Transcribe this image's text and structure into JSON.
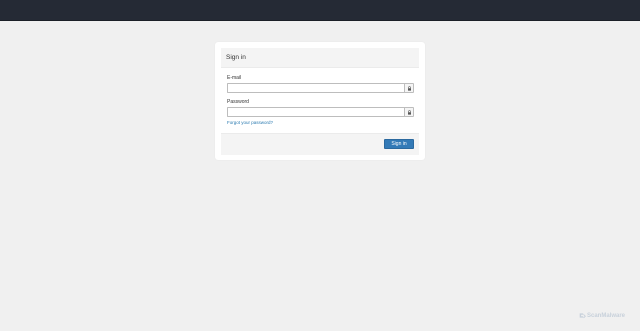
{
  "topbar": {},
  "login": {
    "title": "Sign in",
    "email_label": "E-mail",
    "email_value": "",
    "email_icon": "lock-icon",
    "password_label": "Password",
    "password_value": "",
    "password_icon": "lock-icon",
    "forgot_link": "Forgot your password?",
    "submit_label": "Sign in"
  },
  "watermark": {
    "text": "ScanMalware"
  },
  "colors": {
    "topbar": "#252a35",
    "background": "#f0f0f0",
    "primary_button": "#337ab7",
    "link": "#2a7ab0"
  }
}
